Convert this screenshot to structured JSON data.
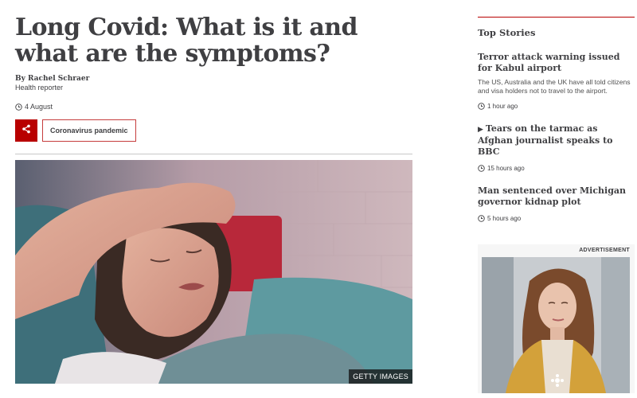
{
  "article": {
    "headline": "Long Covid: What is it and what are the symptoms?",
    "author": "By Rachel Schraer",
    "author_role": "Health reporter",
    "date": "4 August",
    "topic_tag": "Coronavirus pandemic",
    "image_credit": "GETTY IMAGES",
    "icons": {
      "share": "share-icon",
      "date": "clock-icon"
    },
    "colors": {
      "accent": "#b80000",
      "text": "#3f3f42",
      "tag_border": "#c63d3d"
    }
  },
  "sidebar": {
    "title": "Top Stories",
    "stories": [
      {
        "title": "Terror attack warning issued for Kabul airport",
        "summary": "The US, Australia and the UK have all told citizens and visa holders not to travel to the airport.",
        "time": "1 hour ago"
      },
      {
        "video_mark": "▶",
        "title": "Tears on the tarmac as Afghan journalist speaks to BBC",
        "time": "15 hours ago"
      },
      {
        "title": "Man sentenced over Michigan governor kidnap plot",
        "time": "5 hours ago"
      }
    ]
  },
  "advert": {
    "label": "ADVERTISEMENT"
  }
}
